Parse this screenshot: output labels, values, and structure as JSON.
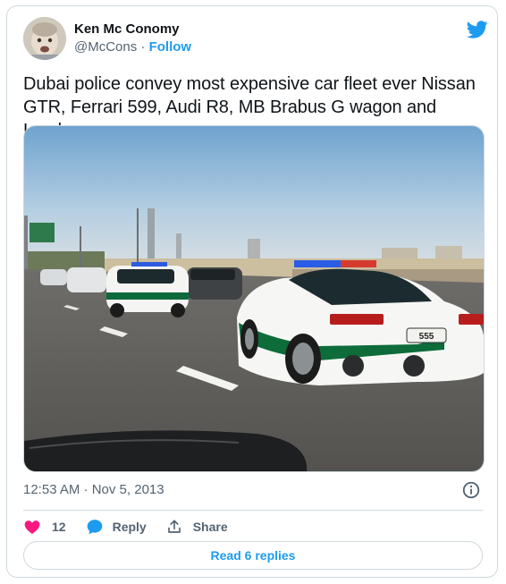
{
  "author": {
    "display_name": "Ken Mc Conomy",
    "handle": "@McCons",
    "separator": "·",
    "follow_label": "Follow"
  },
  "tweet": {
    "text": "Dubai police convey most expensive car fleet ever Nissan GTR, Ferrari 599, Audi R8, MB Brabus G wagon and Lambo",
    "timestamp": "12:53 AM · Nov 5, 2013"
  },
  "media": {
    "plate_text": "555"
  },
  "actions": {
    "like_count": "12",
    "reply_label": "Reply",
    "share_label": "Share"
  },
  "read_replies_label": "Read 6 replies",
  "icons": {
    "brand": "twitter-bird-icon",
    "info": "info-icon",
    "like": "heart-icon",
    "reply": "speech-bubble-icon",
    "share": "share-icon"
  },
  "colors": {
    "accent": "#1d9bf0",
    "like": "#f91880",
    "text_primary": "#0f1419",
    "text_secondary": "#536471",
    "border": "#cfd9de"
  }
}
